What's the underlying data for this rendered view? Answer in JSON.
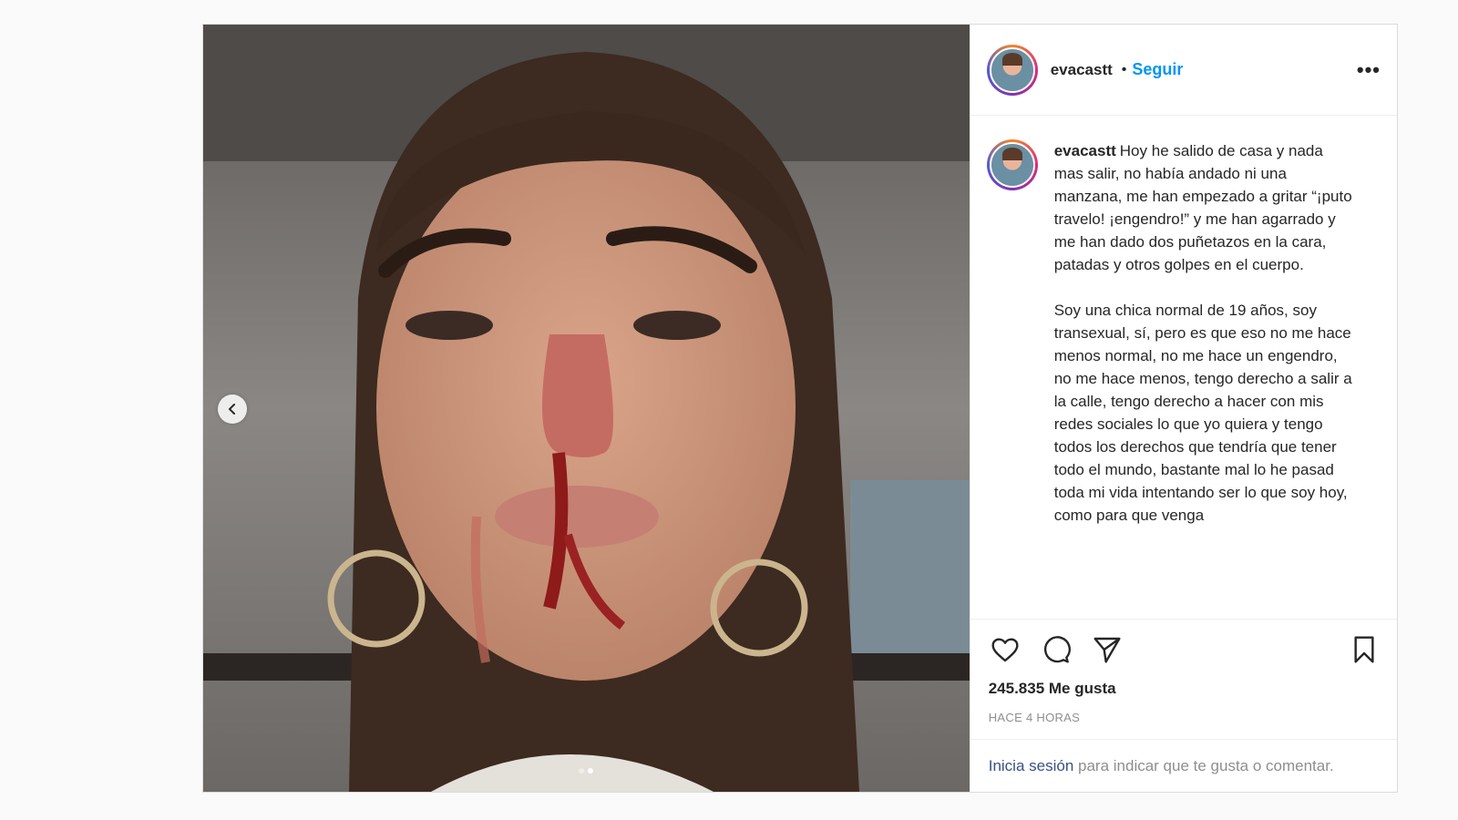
{
  "post": {
    "username": "evacastt",
    "separator": "•",
    "follow_label": "Seguir",
    "more_label": "•••",
    "caption_paragraphs": [
      "Hoy he salido de casa y nada mas salir, no había andado ni una manzana, me han empezado a gritar “¡puto travelo! ¡engendro!” y me han agarrado y me han dado dos puñetazos en la cara, patadas y otros golpes en el cuerpo.",
      "Soy una chica normal de 19 años, soy transexual, sí, pero es que eso no me hace menos normal, no me hace un engendro, no me hace menos, tengo derecho a salir a la calle, tengo derecho a hacer con mis redes sociales lo que yo quiera y tengo todos los derechos que tendría que tener todo el mundo, bastante mal lo he pasad toda mi vida intentando ser lo que soy hoy, como para que venga"
    ],
    "likes": "245.835 Me gusta",
    "timestamp": "HACE 4 HORAS",
    "login_link": "Inicia sesión",
    "login_rest": " para indicar que te gusta o comentar.",
    "carousel": {
      "count": 2,
      "active_index": 1
    }
  },
  "icons": {
    "prev": "chevron-left-icon",
    "like": "heart-icon",
    "comment": "comment-icon",
    "share": "paper-plane-icon",
    "save": "bookmark-icon"
  },
  "colors": {
    "accent": "#0095f6",
    "link": "#385185",
    "muted": "#8e8e8e"
  }
}
